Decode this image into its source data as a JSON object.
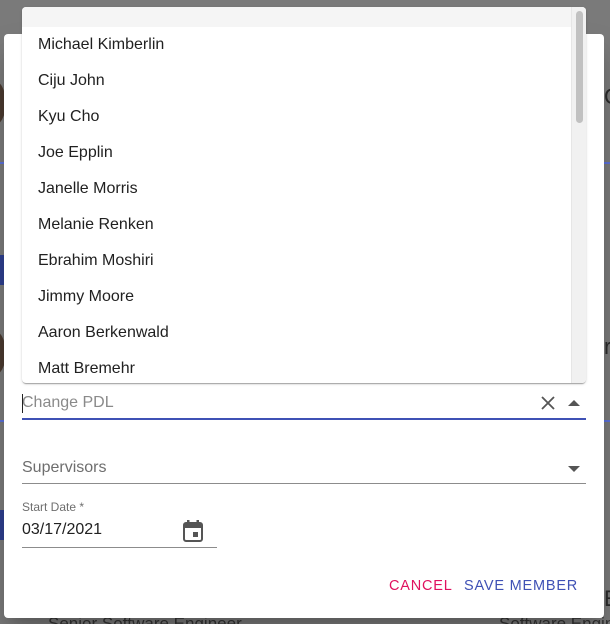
{
  "background": {
    "bottom_left_text": "Senior Software Engineer",
    "bottom_right_text": "Software Engineer"
  },
  "dropdown": {
    "options": [
      "Michael Kimberlin",
      "Ciju John",
      "Kyu Cho",
      "Joe Epplin",
      "Janelle Morris",
      "Melanie Renken",
      "Ebrahim Moshiri",
      "Jimmy Moore",
      "Aaron Berkenwald",
      "Matt Bremehr"
    ]
  },
  "pdl_field": {
    "placeholder": "Change PDL",
    "clear_icon": "close-icon",
    "arrow_icon": "arrow-up-icon"
  },
  "supervisors_field": {
    "label": "Supervisors",
    "arrow_icon": "arrow-down-icon"
  },
  "start_date_field": {
    "label": "Start Date *",
    "value": "03/17/2021",
    "icon": "calendar-icon"
  },
  "actions": {
    "cancel_label": "CANCEL",
    "save_label": "SAVE MEMBER"
  },
  "colors": {
    "primary": "#3f51b5",
    "cancel": "#e0115f"
  }
}
